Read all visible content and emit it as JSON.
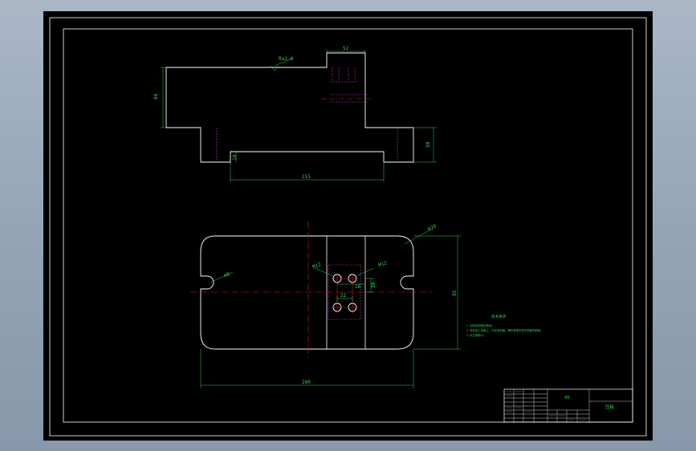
{
  "colors": {
    "background": "#000000",
    "outline": "#ffffff",
    "dimension": "#2fd35a",
    "centerline": "#e02020",
    "hidden": "#d040d0",
    "window": "#a9b7c7"
  },
  "top_view": {
    "dims": {
      "width_top": "52",
      "height_left": "84",
      "height_right": "50",
      "bottom_width": "215",
      "small_height": "10",
      "roughness": "Ra1.6"
    }
  },
  "plan_view": {
    "dims": {
      "overall_width": "280",
      "overall_height": "95",
      "corner_radius": "R20",
      "slot_radius": "R8",
      "hole_left": "M12",
      "hole_right": "M12",
      "hole_spacing": "22",
      "hole_offset": "16",
      "hole_vertical": "30"
    }
  },
  "notes": {
    "title": "技术要求",
    "lines": [
      "1.去除毛刺锐边倒钝。",
      "2.零件加工表面上，不应有划痕、擦伤等损伤零件表面的缺陷。",
      "3.未注倒角C1。"
    ]
  },
  "title_block": {
    "part_name": "压板",
    "material": "45"
  }
}
